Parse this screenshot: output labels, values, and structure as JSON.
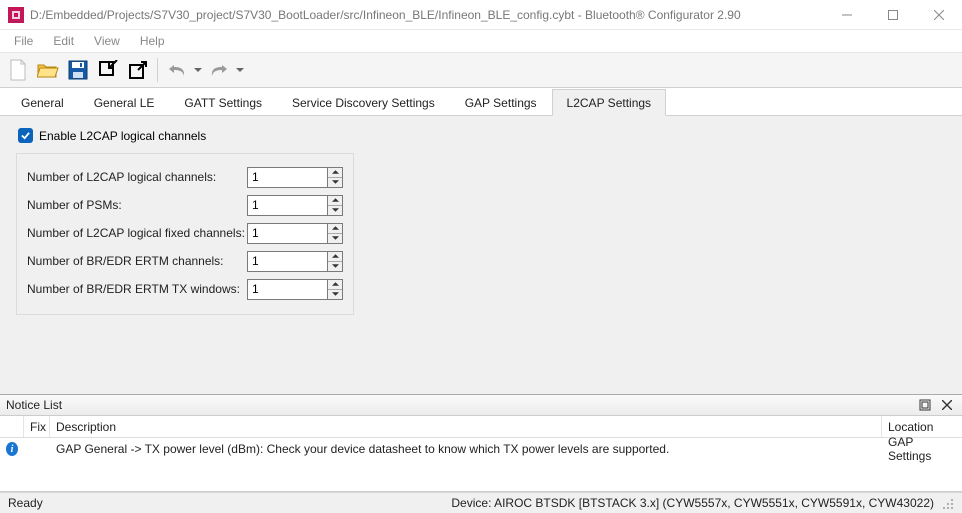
{
  "window": {
    "title": "D:/Embedded/Projects/S7V30_project/S7V30_BootLoader/src/Infineon_BLE/Infineon_BLE_config.cybt - Bluetooth® Configurator 2.90"
  },
  "menu": {
    "file": "File",
    "edit": "Edit",
    "view": "View",
    "help": "Help"
  },
  "tabs": {
    "general": "General",
    "general_le": "General LE",
    "gatt": "GATT Settings",
    "sds": "Service Discovery Settings",
    "gap": "GAP Settings",
    "l2cap": "L2CAP Settings"
  },
  "l2cap": {
    "enable_label": "Enable L2CAP logical channels",
    "rows": {
      "logical_channels": {
        "label": "Number of L2CAP logical channels:",
        "value": "1"
      },
      "psms": {
        "label": "Number of PSMs:",
        "value": "1"
      },
      "fixed_channels": {
        "label": "Number of L2CAP logical fixed channels:",
        "value": "1"
      },
      "ertm_channels": {
        "label": "Number of BR/EDR ERTM channels:",
        "value": "1"
      },
      "ertm_tx_windows": {
        "label": "Number of BR/EDR ERTM TX windows:",
        "value": "1"
      }
    }
  },
  "notice": {
    "title": "Notice List",
    "columns": {
      "fix": "Fix",
      "description": "Description",
      "location": "Location"
    },
    "rows": [
      {
        "description": "GAP General -> TX power level (dBm): Check your device datasheet to know which TX power levels are supported.",
        "location": "GAP Settings"
      }
    ]
  },
  "status": {
    "ready": "Ready",
    "device": "Device: AIROC BTSDK [BTSTACK 3.x] (CYW5557x, CYW5551x, CYW5591x, CYW43022)"
  }
}
